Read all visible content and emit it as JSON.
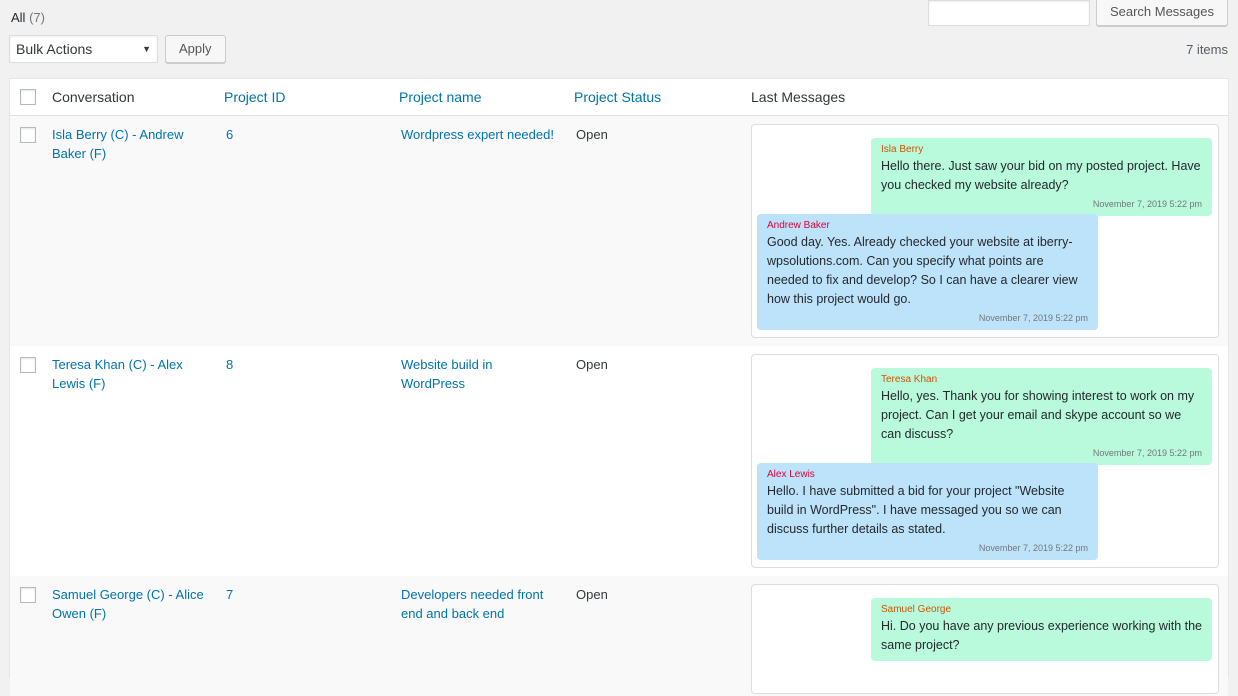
{
  "filter": {
    "label": "All",
    "count": "(7)"
  },
  "search": {
    "value": "",
    "button": "Search Messages"
  },
  "bulk": {
    "selected": "Bulk Actions",
    "apply": "Apply"
  },
  "items_count": "7 items",
  "columns": {
    "conversation": "Conversation",
    "project_id": "Project ID",
    "project_name": "Project name",
    "project_status": "Project Status",
    "last_messages": "Last Messages"
  },
  "rows": [
    {
      "conversation": "Isla Berry (C) - Andrew Baker (F)",
      "project_id": "6",
      "project_name": "Wordpress expert needed!",
      "status": "Open",
      "messages": [
        {
          "author": "Isla Berry",
          "text": "Hello there. Just saw your bid on my posted project. Have you checked my website already?",
          "time": "November 7, 2019 5:22 pm"
        },
        {
          "author": "Andrew Baker",
          "text": "Good day. Yes. Already checked your website at iberry-wpsolutions.com. Can you specify what points are needed to fix and develop? So I can have a clearer view how this project would go.",
          "time": "November 7, 2019 5:22 pm"
        }
      ]
    },
    {
      "conversation": "Teresa Khan (C) - Alex Lewis (F)",
      "project_id": "8",
      "project_name": "Website build in WordPress",
      "status": "Open",
      "messages": [
        {
          "author": "Teresa Khan",
          "text": "Hello, yes. Thank you for showing interest to work on my project. Can I get your email and skype account so we can discuss?",
          "time": "November 7, 2019 5:22 pm"
        },
        {
          "author": "Alex Lewis",
          "text": "Hello. I have submitted a bid for your project \"Website build in WordPress\". I have messaged you so we can discuss further details as stated.",
          "time": "November 7, 2019 5:22 pm"
        }
      ]
    },
    {
      "conversation": "Samuel George (C) - Alice Owen (F)",
      "project_id": "7",
      "project_name": "Developers needed front end and back end",
      "status": "Open",
      "messages": [
        {
          "author": "Samuel George",
          "text": "Hi. Do you have any previous experience working with the same project?",
          "time": ""
        }
      ]
    }
  ]
}
